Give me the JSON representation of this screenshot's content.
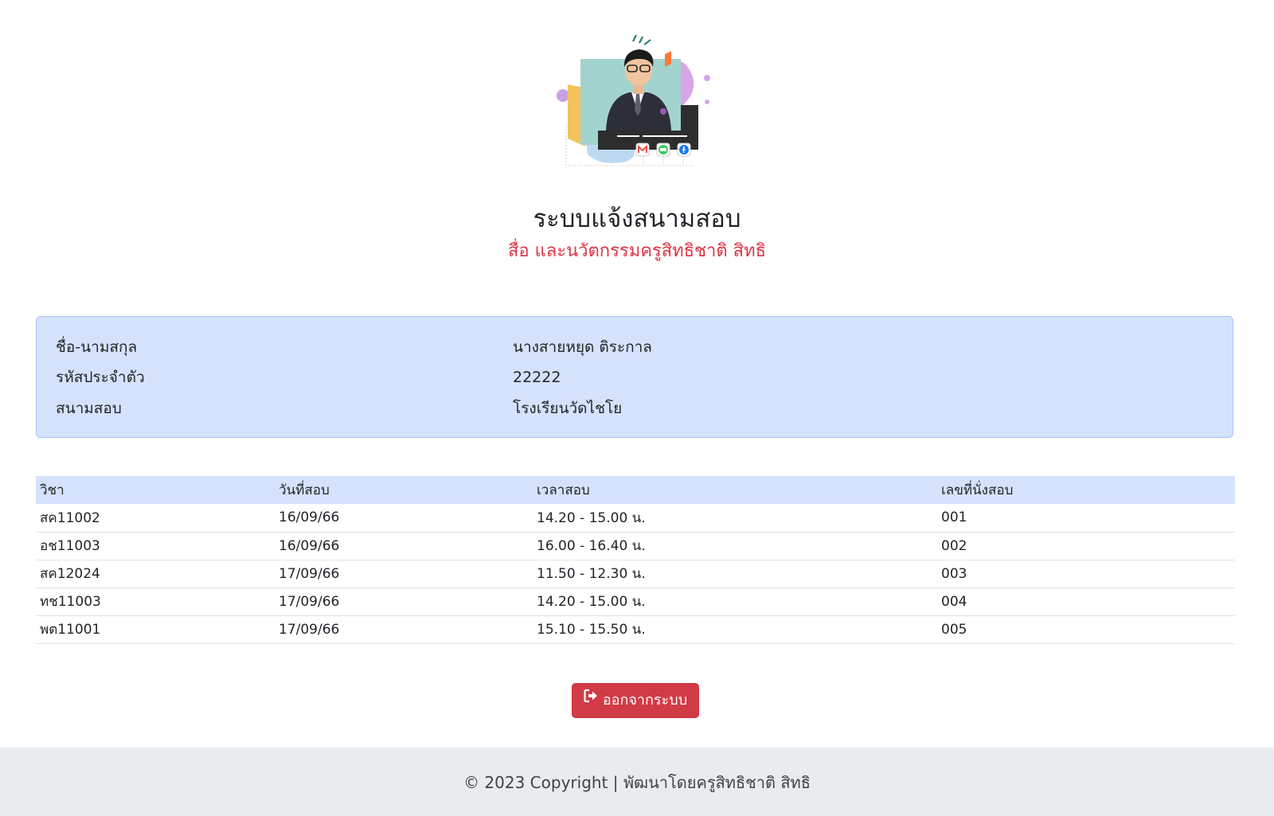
{
  "header": {
    "image_alt": "ภาพครูสิทธิชาติ สิทธิ",
    "title": "ระบบแจ้งสนามสอบ",
    "subtitle": "สื่อ และนวัตกรรมครูสิทธิชาติ สิทธิ"
  },
  "colors": {
    "accent_red": "#dc3545",
    "panel_blue": "#d5e2fc",
    "footer_gray": "#e9ecef"
  },
  "student": {
    "rows": [
      {
        "label": "ชื่อ-นามสกุล",
        "value": "นางสายหยุด ติระกาล"
      },
      {
        "label": "รหัสประจำตัว",
        "value": "22222"
      },
      {
        "label": "สนามสอบ",
        "value": "โรงเรียนวัดไชโย"
      }
    ]
  },
  "exam_table": {
    "headers": [
      "วิชา",
      "วันที่สอบ",
      "เวลาสอบ",
      "เลขที่นั่งสอบ"
    ],
    "rows": [
      [
        "สค11002",
        "16/09/66",
        "14.20 - 15.00 น.",
        "001"
      ],
      [
        "อช11003",
        "16/09/66",
        "16.00 - 16.40 น.",
        "002"
      ],
      [
        "สค12024",
        "17/09/66",
        "11.50 - 12.30 น.",
        "003"
      ],
      [
        "ทช11003",
        "17/09/66",
        "14.20 - 15.00 น.",
        "004"
      ],
      [
        "พต11001",
        "17/09/66",
        "15.10 - 15.50 น.",
        "005"
      ]
    ]
  },
  "actions": {
    "logout_label": "ออกจากระบบ",
    "logout_icon": "sign-out-icon"
  },
  "footer": {
    "text": "© 2023 Copyright | พัฒนาโดยครูสิทธิชาติ สิทธิ"
  }
}
